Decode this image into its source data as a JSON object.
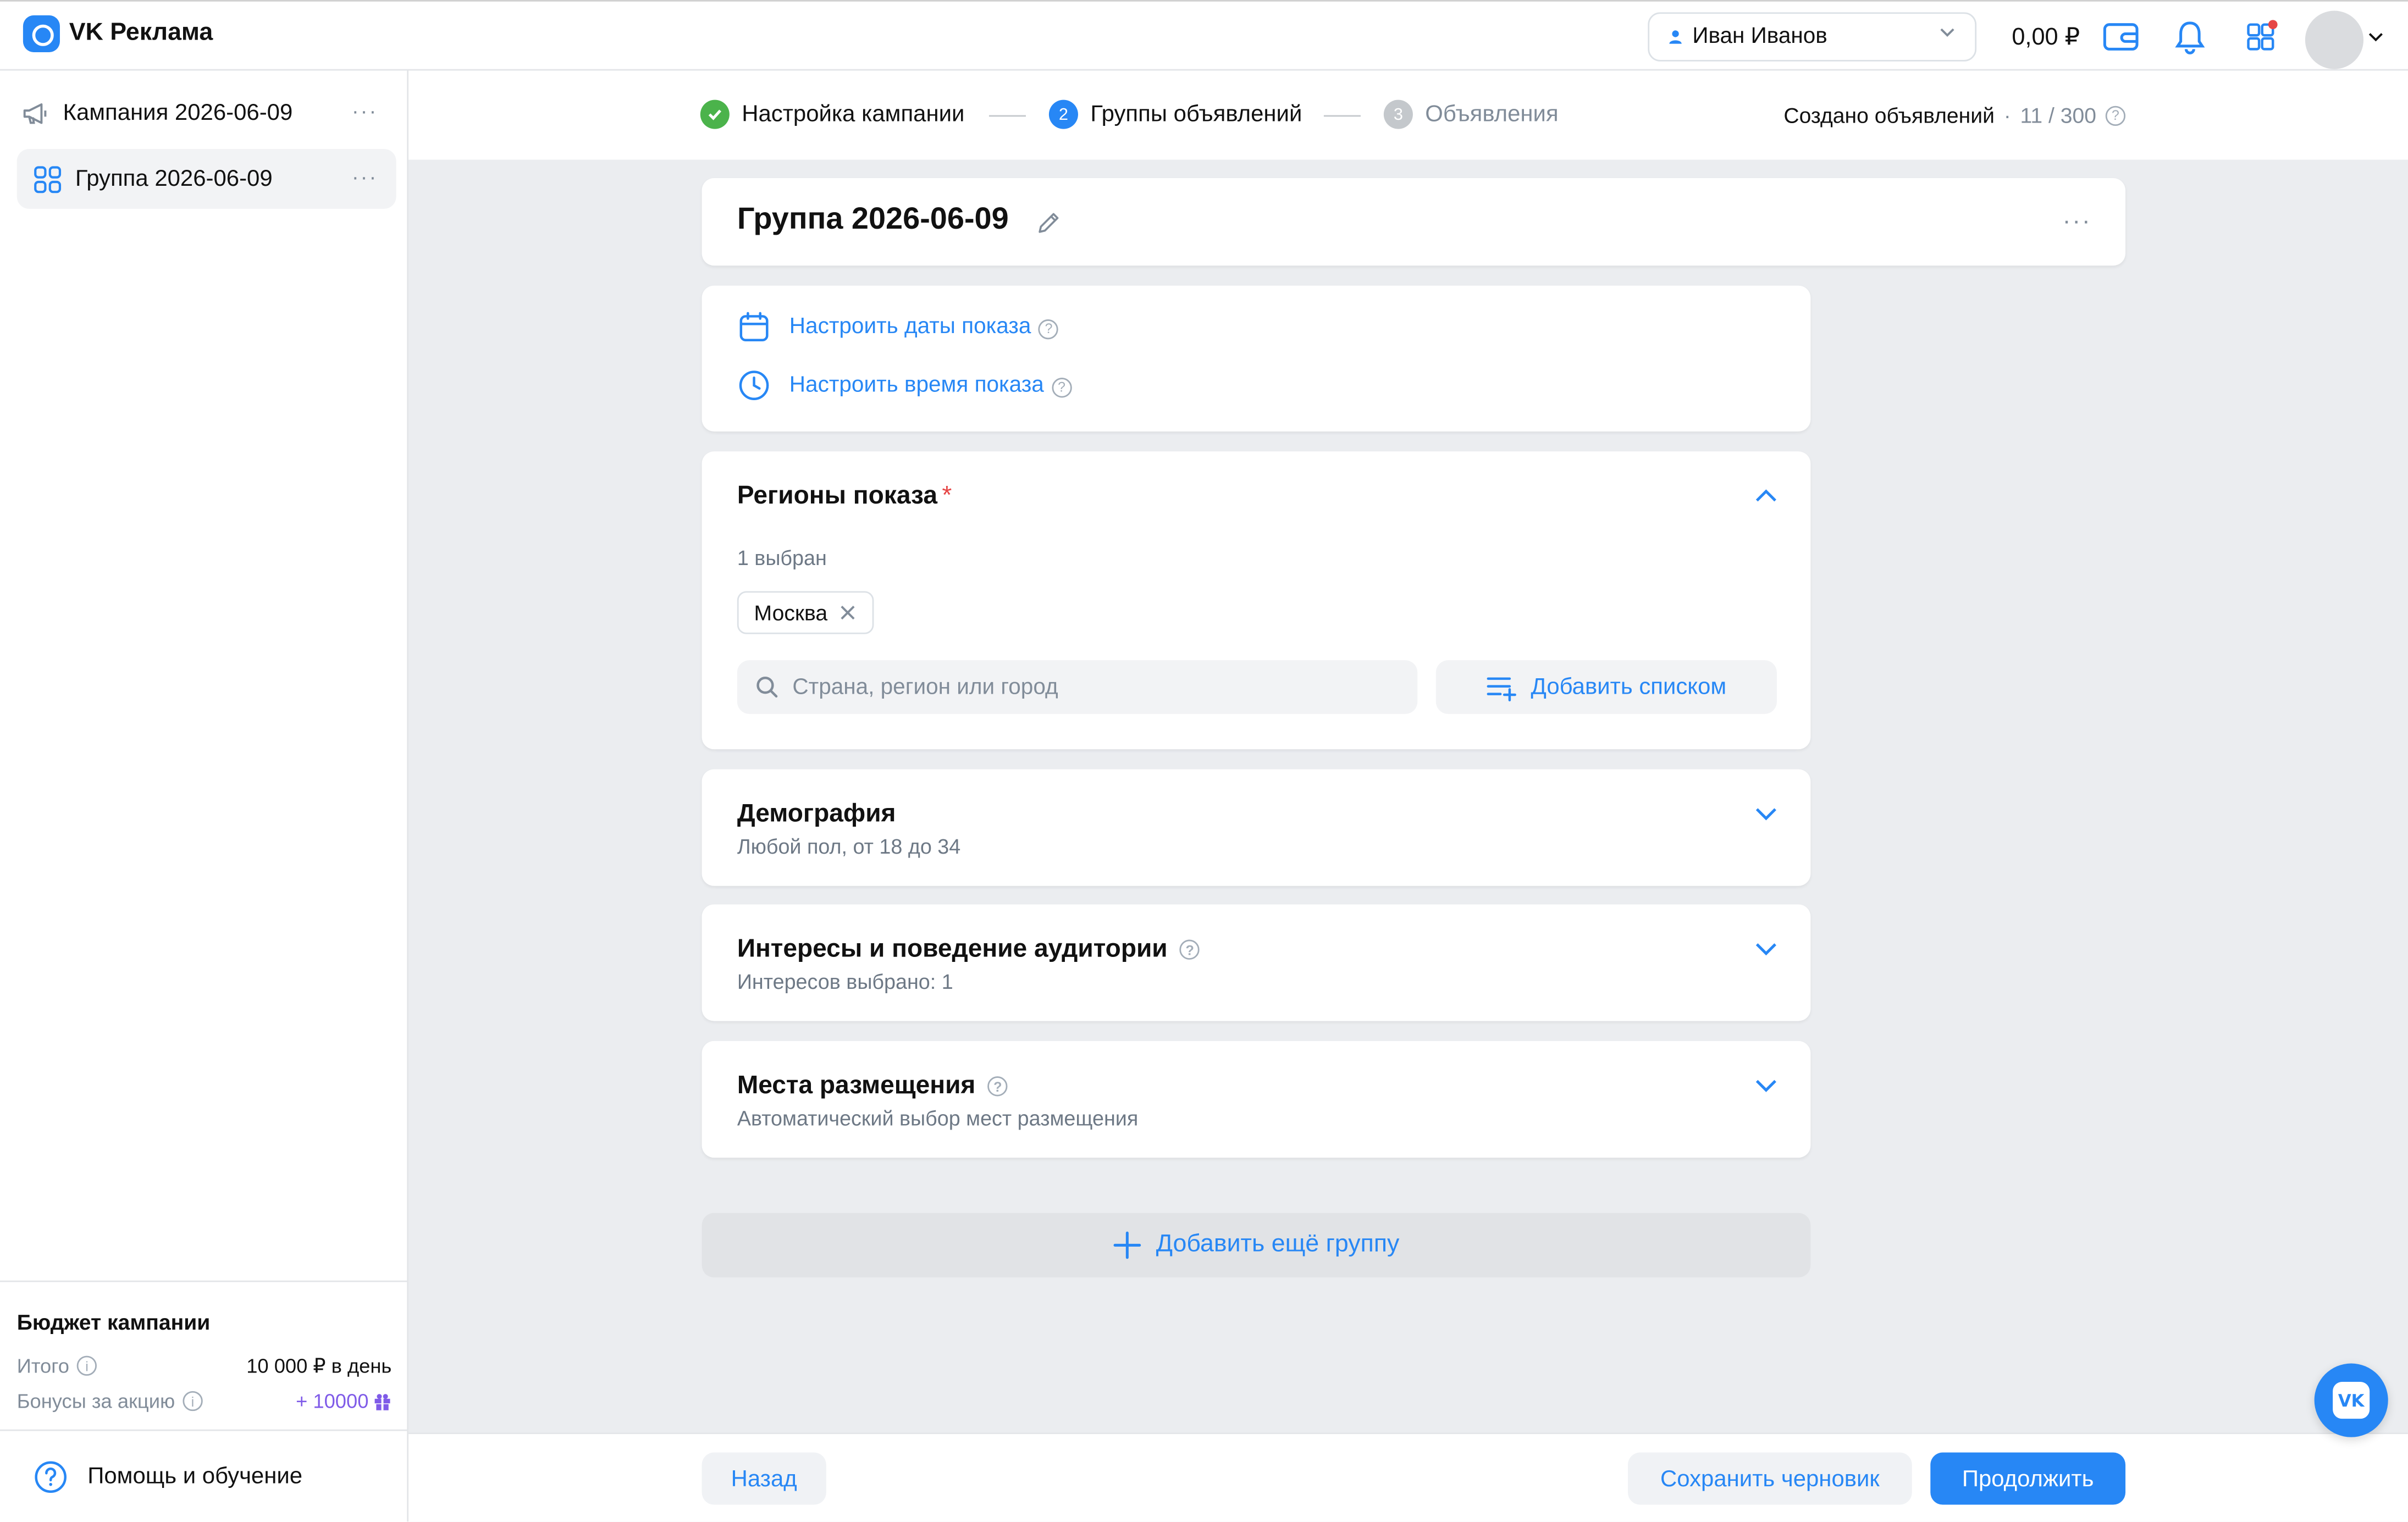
{
  "app": {
    "title": "VK Реклама"
  },
  "header": {
    "account_name": "Иван Иванов",
    "balance": "0,00 ₽"
  },
  "sidebar": {
    "items": [
      {
        "label": "Кампания 2026-06-09",
        "more": "···"
      },
      {
        "label": "Группа 2026-06-09",
        "more": "···"
      }
    ],
    "budget": {
      "title": "Бюджет кампании",
      "total_label": "Итого",
      "total_value": "10 000 ₽ в день",
      "bonus_label": "Бонусы за акцию",
      "bonus_value": "+ 10000"
    },
    "help_label": "Помощь и обучение"
  },
  "steps": [
    {
      "num": "1",
      "label": "Настройка кампании",
      "state": "done"
    },
    {
      "num": "2",
      "label": "Группы объявлений",
      "state": "active"
    },
    {
      "num": "3",
      "label": "Объявления",
      "state": "pending"
    }
  ],
  "created": {
    "label": "Создано объявлений",
    "separator": "·",
    "count": "11 / 300"
  },
  "group": {
    "title": "Группа 2026-06-09",
    "more": "···"
  },
  "schedule": {
    "dates_link": "Настроить даты показа",
    "time_link": "Настроить время показа"
  },
  "regions": {
    "title": "Регионы показа",
    "required_mark": "*",
    "selected_count": "1 выбран",
    "chips": [
      "Москва"
    ],
    "search_placeholder": "Страна, регион или город",
    "add_list_label": "Добавить списком"
  },
  "demography": {
    "title": "Демография",
    "summary": "Любой пол, от 18 до 34"
  },
  "interests": {
    "title": "Интересы и поведение аудитории",
    "summary": "Интересов выбрано: 1"
  },
  "placements": {
    "title": "Места размещения",
    "summary": "Автоматический выбор мест размещения"
  },
  "add_group_label": "Добавить ещё группу",
  "footer": {
    "back_label": "Назад",
    "save_draft_label": "Сохранить черновик",
    "continue_label": "Продолжить"
  },
  "fab": {
    "label": "VK"
  },
  "colors": {
    "accent": "#2787f5",
    "success": "#4bb34b",
    "required": "#e64646",
    "bonus": "#7f5be8",
    "content_bg": "#ebedf0"
  }
}
